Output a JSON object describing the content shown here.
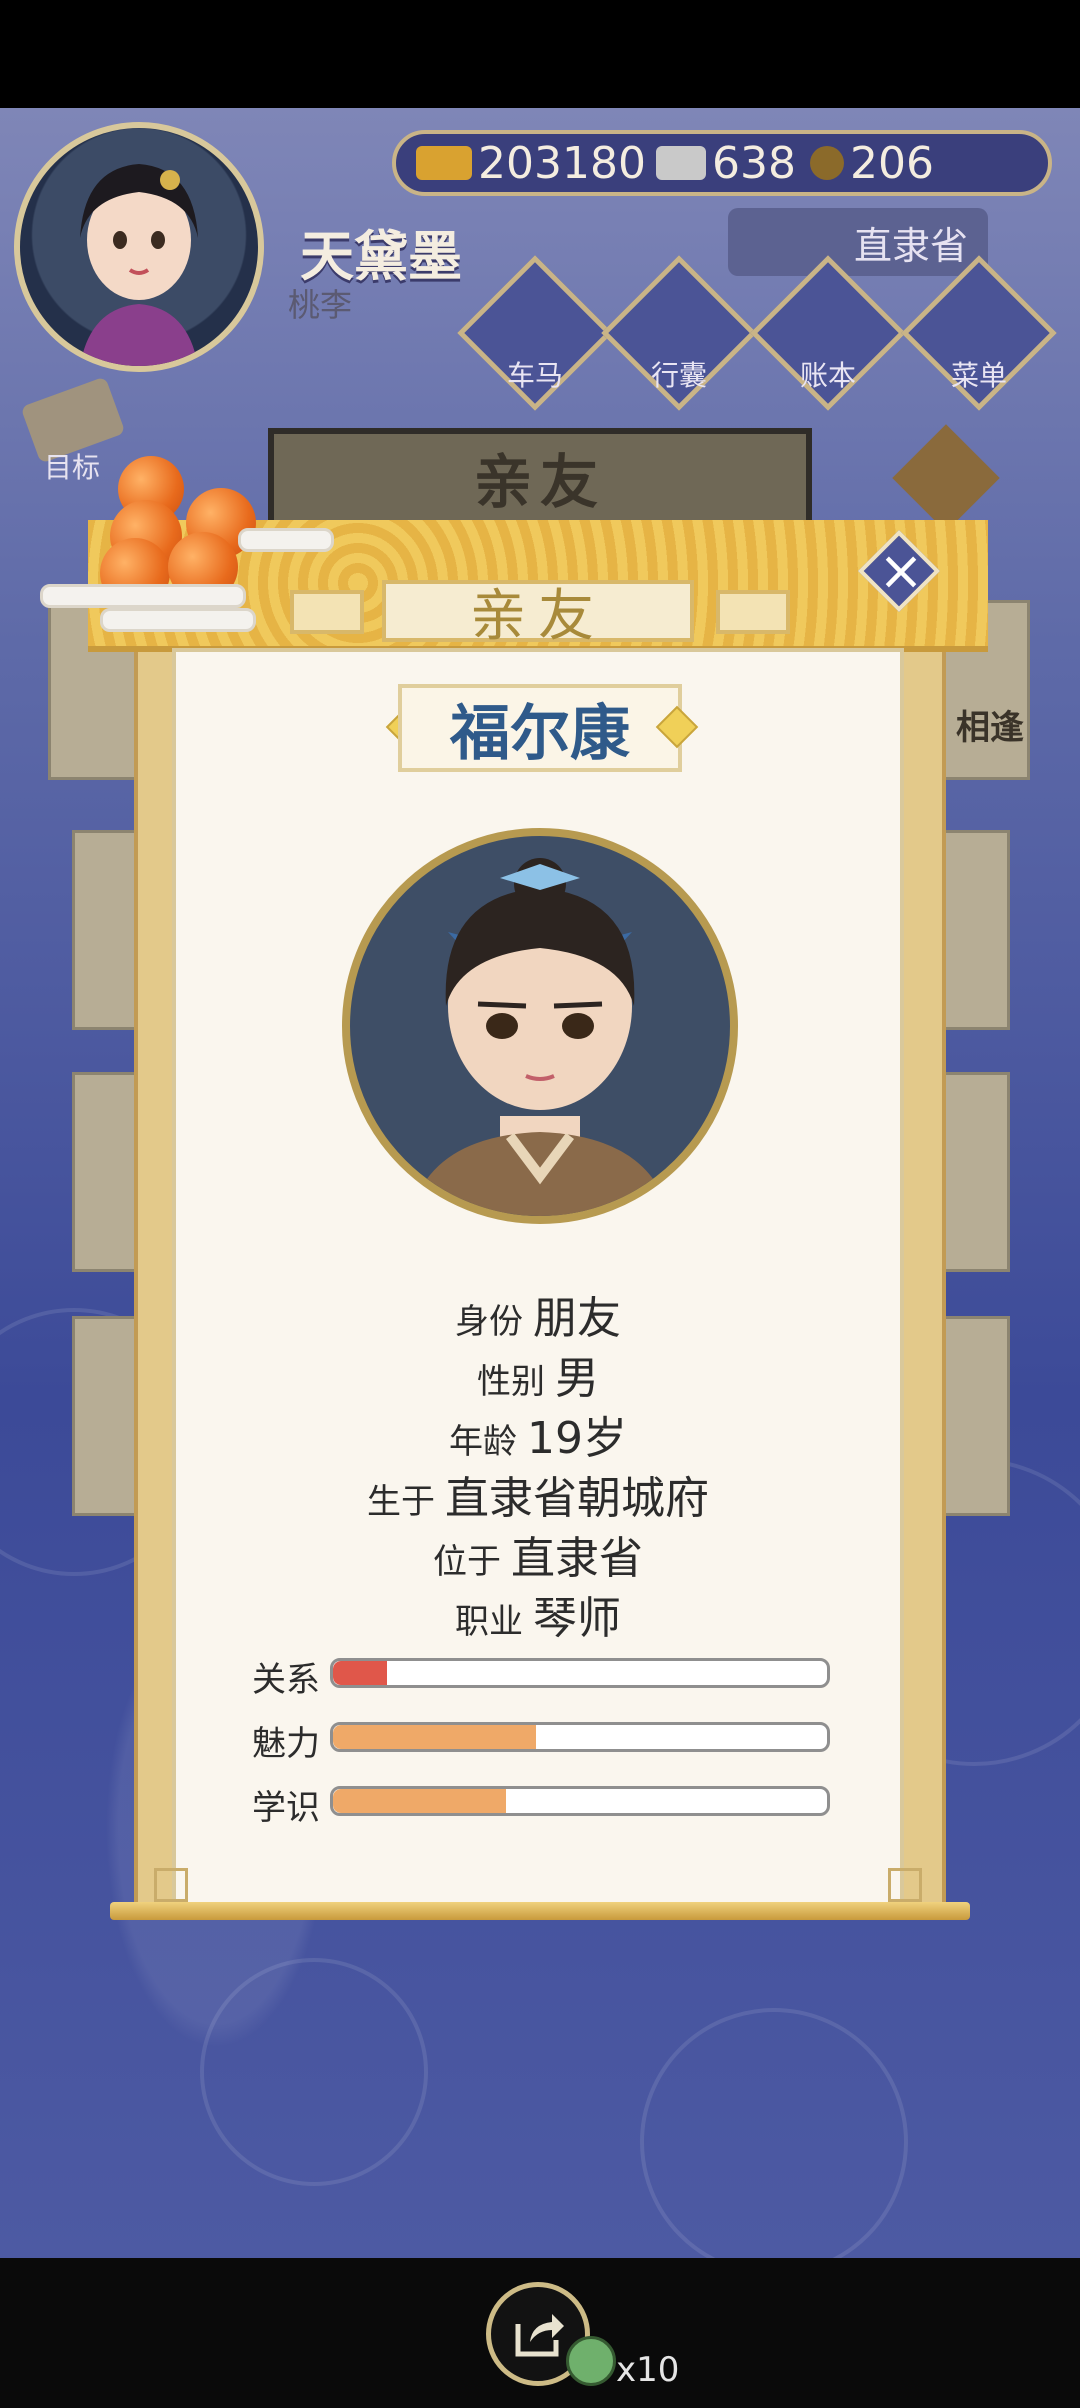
{
  "player": {
    "name": "天黛墨",
    "subtitle": "桃李"
  },
  "currency": [
    {
      "icon": "gold-ingot-icon",
      "value": "203180"
    },
    {
      "icon": "silver-ingot-icon",
      "value": "638"
    },
    {
      "icon": "copper-coin-icon",
      "value": "206"
    }
  ],
  "location": "直隶省",
  "nav": [
    {
      "label": "车马",
      "icon": "carriage-icon"
    },
    {
      "label": "行囊",
      "icon": "bag-icon"
    },
    {
      "label": "账本",
      "icon": "ledger-icon"
    },
    {
      "label": "菜单",
      "icon": "menu-icon"
    }
  ],
  "goal_label": "目标",
  "under_panel": {
    "title": "亲友",
    "side_label": "相逢"
  },
  "dialog": {
    "title": "亲友",
    "character_name": "福尔康",
    "info": [
      {
        "key": "身份",
        "value": "朋友"
      },
      {
        "key": "性别",
        "value": "男"
      },
      {
        "key": "年龄",
        "value": "19岁"
      },
      {
        "key": "生于",
        "value": "直隶省朝城府"
      },
      {
        "key": "位于",
        "value": "直隶省"
      },
      {
        "key": "职业",
        "value": "琴师"
      }
    ],
    "stats": [
      {
        "label": "关系",
        "fraction": 0.11,
        "color": "#e0574a"
      },
      {
        "label": "魅力",
        "fraction": 0.41,
        "color": "#efa968"
      },
      {
        "label": "学识",
        "fraction": 0.35,
        "color": "#efa968"
      }
    ]
  },
  "share": {
    "count_label": "x10"
  }
}
